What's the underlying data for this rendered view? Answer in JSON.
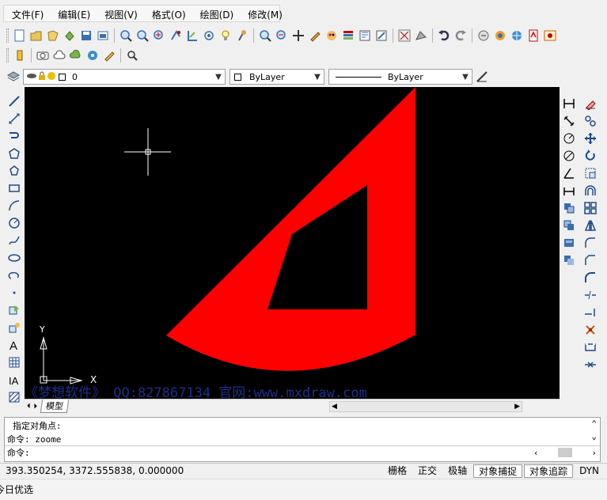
{
  "menus": [
    "文件(F)",
    "编辑(E)",
    "视图(V)",
    "格式(O)",
    "绘图(D)",
    "修改(M)"
  ],
  "layer": {
    "name": "0",
    "linetype_color": "ByLayer",
    "lineweight": "ByLayer"
  },
  "drawing": {
    "shape_color": "#ff0000",
    "watermark": "《梦想软件》  QQ:827867134  官网:www.mxdraw.com",
    "ucs_y": "Y",
    "ucs_x": "X"
  },
  "tabs": {
    "model": "模型"
  },
  "command": {
    "history_line1": "指定对角点:",
    "history_line2": "命令:  zoome",
    "prompt": "命令:"
  },
  "status": {
    "coords": "393.350254,  3372.555838,  0.000000",
    "toggles": [
      "栅格",
      "正交",
      "极轴",
      "对象捕捉",
      "对象追踪",
      "DYN"
    ],
    "active": [
      "对象捕捉",
      "对象追踪"
    ]
  },
  "taskbar": {
    "label": "今日优选"
  },
  "icons": {
    "toolbar1": [
      "new-icon",
      "open-icon",
      "save-icon",
      "print-icon",
      "preview-icon",
      "publish-icon",
      "zoom-realtime-icon",
      "zoom-window-icon",
      "zoom-extents-icon",
      "pan-icon",
      "zoom-previous-icon",
      "zoom-in-icon",
      "light-icon",
      "render-icon",
      "zoom-icon",
      "zoom-out-icon",
      "pan-move-icon",
      "pencil-icon",
      "matchprop-icon",
      "color-icon",
      "layer-icon",
      "block-icon",
      "xref-icon",
      "undo-icon",
      "redo-icon",
      "recycle-icon",
      "color-wheel-icon",
      "pdf-icon",
      "image-icon"
    ]
  }
}
